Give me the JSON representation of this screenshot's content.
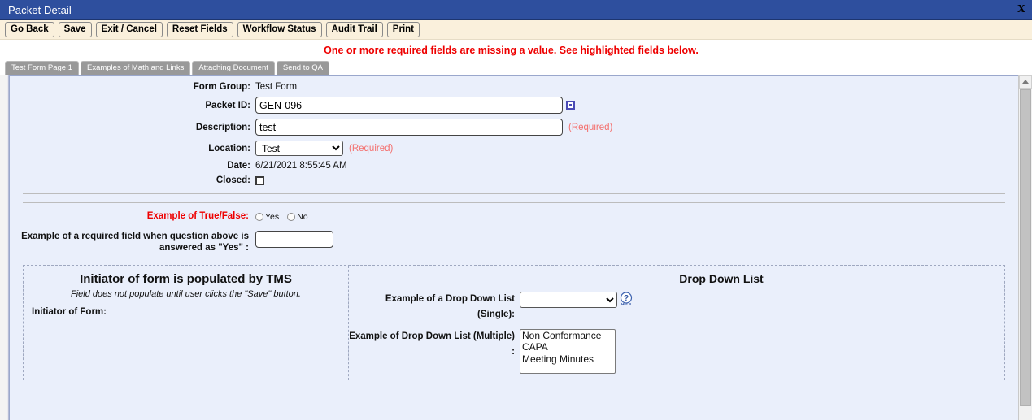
{
  "window": {
    "title": "Packet Detail",
    "close_label": "X"
  },
  "toolbar": {
    "buttons": [
      {
        "label": "Go Back",
        "name": "go-back-button"
      },
      {
        "label": "Save",
        "name": "save-button"
      },
      {
        "label": "Exit / Cancel",
        "name": "exit-cancel-button"
      },
      {
        "label": "Reset Fields",
        "name": "reset-fields-button"
      },
      {
        "label": "Workflow Status",
        "name": "workflow-status-button"
      },
      {
        "label": "Audit Trail",
        "name": "audit-trail-button"
      },
      {
        "label": "Print",
        "name": "print-button"
      }
    ]
  },
  "error_banner": {
    "message": "One or more required fields are missing a value. See highlighted fields below.",
    "color": "#ee0000"
  },
  "tabs": [
    {
      "label": "Test Form Page 1",
      "active": true
    },
    {
      "label": "Examples of Math and Links",
      "active": false
    },
    {
      "label": "Attaching Document",
      "active": false
    },
    {
      "label": "Send to QA",
      "active": false
    }
  ],
  "form": {
    "form_group": {
      "label": "Form Group:",
      "value": "Test Form"
    },
    "packet_id": {
      "label": "Packet ID:",
      "value": "GEN-096"
    },
    "description": {
      "label": "Description:",
      "value": "test",
      "required_note": "(Required)"
    },
    "location": {
      "label": "Location:",
      "value": "Test",
      "required_note": "(Required)",
      "options": [
        "Test"
      ]
    },
    "date": {
      "label": "Date:",
      "value": "6/21/2021 8:55:45 AM"
    },
    "closed": {
      "label": "Closed:",
      "checked": false
    }
  },
  "true_false": {
    "label": "Example of True/False:",
    "options": [
      {
        "label": "Yes",
        "selected": false
      },
      {
        "label": "No",
        "selected": false
      }
    ]
  },
  "conditional_required": {
    "label_line1": "Example of a required field when question above is",
    "label_line2": "answered as \"Yes\" :",
    "value": ""
  },
  "panel_left": {
    "title": "Initiator of form is populated by TMS",
    "subtitle": "Field does not populate until user clicks the \"Save\" button.",
    "field_label": "Initiator of Form:",
    "field_value": ""
  },
  "panel_right": {
    "title": "Drop Down List",
    "single": {
      "label": "Example of a Drop Down List (Single):",
      "value": "",
      "options": [
        ""
      ],
      "help_icon_text": "HELP"
    },
    "multiple": {
      "label": "Example of Drop Down List (Multiple) :",
      "options": [
        "Non Conformance",
        "CAPA",
        "Meeting Minutes"
      ]
    }
  },
  "colors": {
    "titlebar": "#2e4f9e",
    "toolbar": "#faf0dc",
    "content_bg": "#eaeffb",
    "tab": "#999999",
    "required_text": "#f4706e",
    "error_text": "#ee0000"
  }
}
